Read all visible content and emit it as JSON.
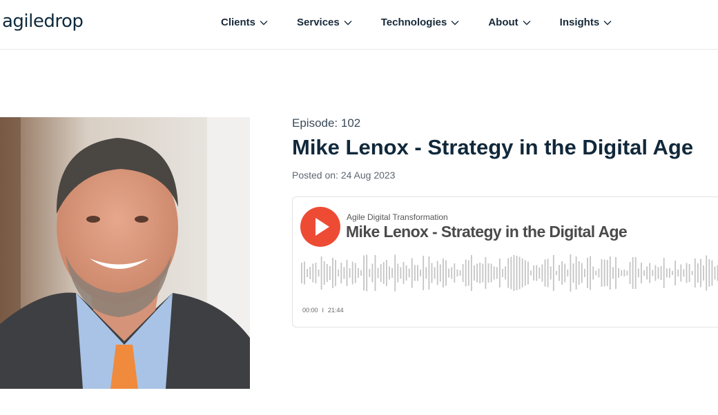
{
  "header": {
    "logo": "agiledrop",
    "nav": [
      {
        "label": "Clients"
      },
      {
        "label": "Services"
      },
      {
        "label": "Technologies"
      },
      {
        "label": "About"
      },
      {
        "label": "Insights"
      }
    ]
  },
  "episode": {
    "label": "Episode: 102",
    "title": "Mike Lenox - Strategy in the Digital Age",
    "posted": "Posted on: 24 Aug 2023"
  },
  "player": {
    "show_name": "Agile Digital Transformation",
    "title": "Mike Lenox - Strategy in the Digital Age",
    "current_time": "00:00",
    "duration": "21:44",
    "accent": "#ee4b35"
  }
}
